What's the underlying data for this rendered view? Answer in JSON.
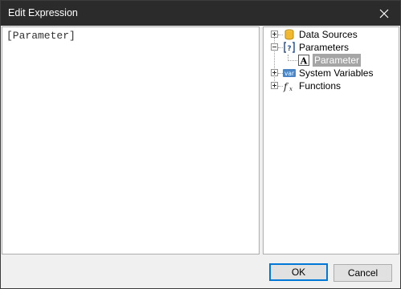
{
  "window": {
    "title": "Edit Expression"
  },
  "editor": {
    "value": "[Parameter]"
  },
  "tree": {
    "items": [
      {
        "label": "Data Sources",
        "icon": "database-icon",
        "expanded": false
      },
      {
        "label": "Parameters",
        "icon": "parameters-icon",
        "expanded": true
      },
      {
        "label": "Parameter",
        "icon": "text-parameter-icon",
        "selected": true
      },
      {
        "label": "System Variables",
        "icon": "var-icon",
        "expanded": false
      },
      {
        "label": "Functions",
        "icon": "function-icon",
        "expanded": false
      }
    ]
  },
  "buttons": {
    "ok": "OK",
    "cancel": "Cancel"
  },
  "colors": {
    "titlebar": "#2b2b2b",
    "accent": "#0078d7",
    "selection": "#a5a5a5"
  }
}
